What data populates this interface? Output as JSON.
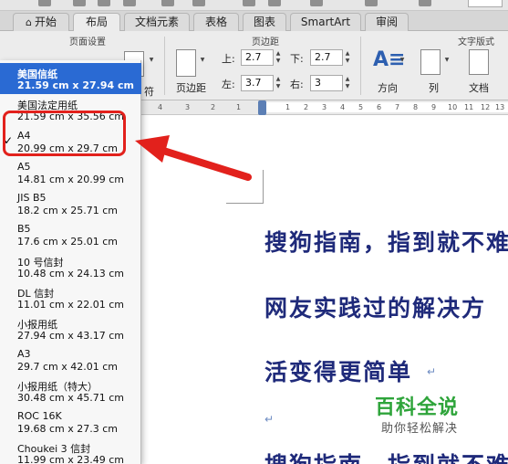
{
  "tabs": [
    {
      "label": "开始",
      "active": false
    },
    {
      "label": "布局",
      "active": true
    },
    {
      "label": "文档元素",
      "active": false
    },
    {
      "label": "表格",
      "active": false
    },
    {
      "label": "图表",
      "active": false
    },
    {
      "label": "SmartArt",
      "active": false
    },
    {
      "label": "审阅",
      "active": false
    }
  ],
  "ribbon": {
    "group_page_setup": "页面设置",
    "group_margins": "页边距",
    "group_text_style": "文字版式",
    "partial_label": "符",
    "margins_button": "页边距",
    "top_label": "上:",
    "top_value": "2.7",
    "bottom_label": "下:",
    "bottom_value": "2.7",
    "left_label": "左:",
    "left_value": "3.7",
    "right_label": "右:",
    "right_value": "3",
    "direction_button": "方向",
    "columns_button": "列",
    "document_button": "文档"
  },
  "paper_sizes": [
    {
      "name": "美国信纸",
      "size": "21.59 cm x 27.94 cm",
      "highlighted": true,
      "checked": false
    },
    {
      "name": "美国法定用纸",
      "size": "21.59 cm x 35.56 cm",
      "highlighted": false,
      "checked": false
    },
    {
      "name": "A4",
      "size": "20.99 cm x 29.7 cm",
      "highlighted": false,
      "checked": true
    },
    {
      "name": "A5",
      "size": "14.81 cm x 20.99 cm",
      "highlighted": false,
      "checked": false
    },
    {
      "name": "JIS B5",
      "size": "18.2 cm x 25.71 cm",
      "highlighted": false,
      "checked": false
    },
    {
      "name": "B5",
      "size": "17.6 cm x 25.01 cm",
      "highlighted": false,
      "checked": false
    },
    {
      "name": "10 号信封",
      "size": "10.48 cm x 24.13 cm",
      "highlighted": false,
      "checked": false
    },
    {
      "name": "DL 信封",
      "size": "11.01 cm x 22.01 cm",
      "highlighted": false,
      "checked": false
    },
    {
      "name": "小报用纸",
      "size": "27.94 cm x 43.17 cm",
      "highlighted": false,
      "checked": false
    },
    {
      "name": "A3",
      "size": "29.7 cm x 42.01 cm",
      "highlighted": false,
      "checked": false
    },
    {
      "name": "小报用纸（特大）",
      "size": "30.48 cm x 45.71 cm",
      "highlighted": false,
      "checked": false
    },
    {
      "name": "ROC 16K",
      "size": "19.68 cm x 27.3 cm",
      "highlighted": false,
      "checked": false
    },
    {
      "name": "Choukei 3 信封",
      "size": "11.99 cm x 23.49 cm",
      "highlighted": false,
      "checked": false
    }
  ],
  "check_mark": "✓",
  "ruler_numbers": [
    "4",
    "3",
    "2",
    "1",
    "1",
    "2",
    "3",
    "4",
    "5",
    "6",
    "7",
    "8",
    "9",
    "10",
    "11",
    "12",
    "13",
    "14"
  ],
  "document_lines": [
    "搜狗指南，指到就不难",
    "网友实践过的解决方",
    "活变得更简单",
    "",
    "搜狗指南，指到就不难"
  ],
  "watermark": {
    "title": "百科全说",
    "subtitle": "助你轻松解决"
  },
  "colors": {
    "highlight": "#2a6ad3",
    "annotation_red": "#e2211c",
    "document_text": "#1f2a7a",
    "watermark_green": "#2ea43a"
  }
}
